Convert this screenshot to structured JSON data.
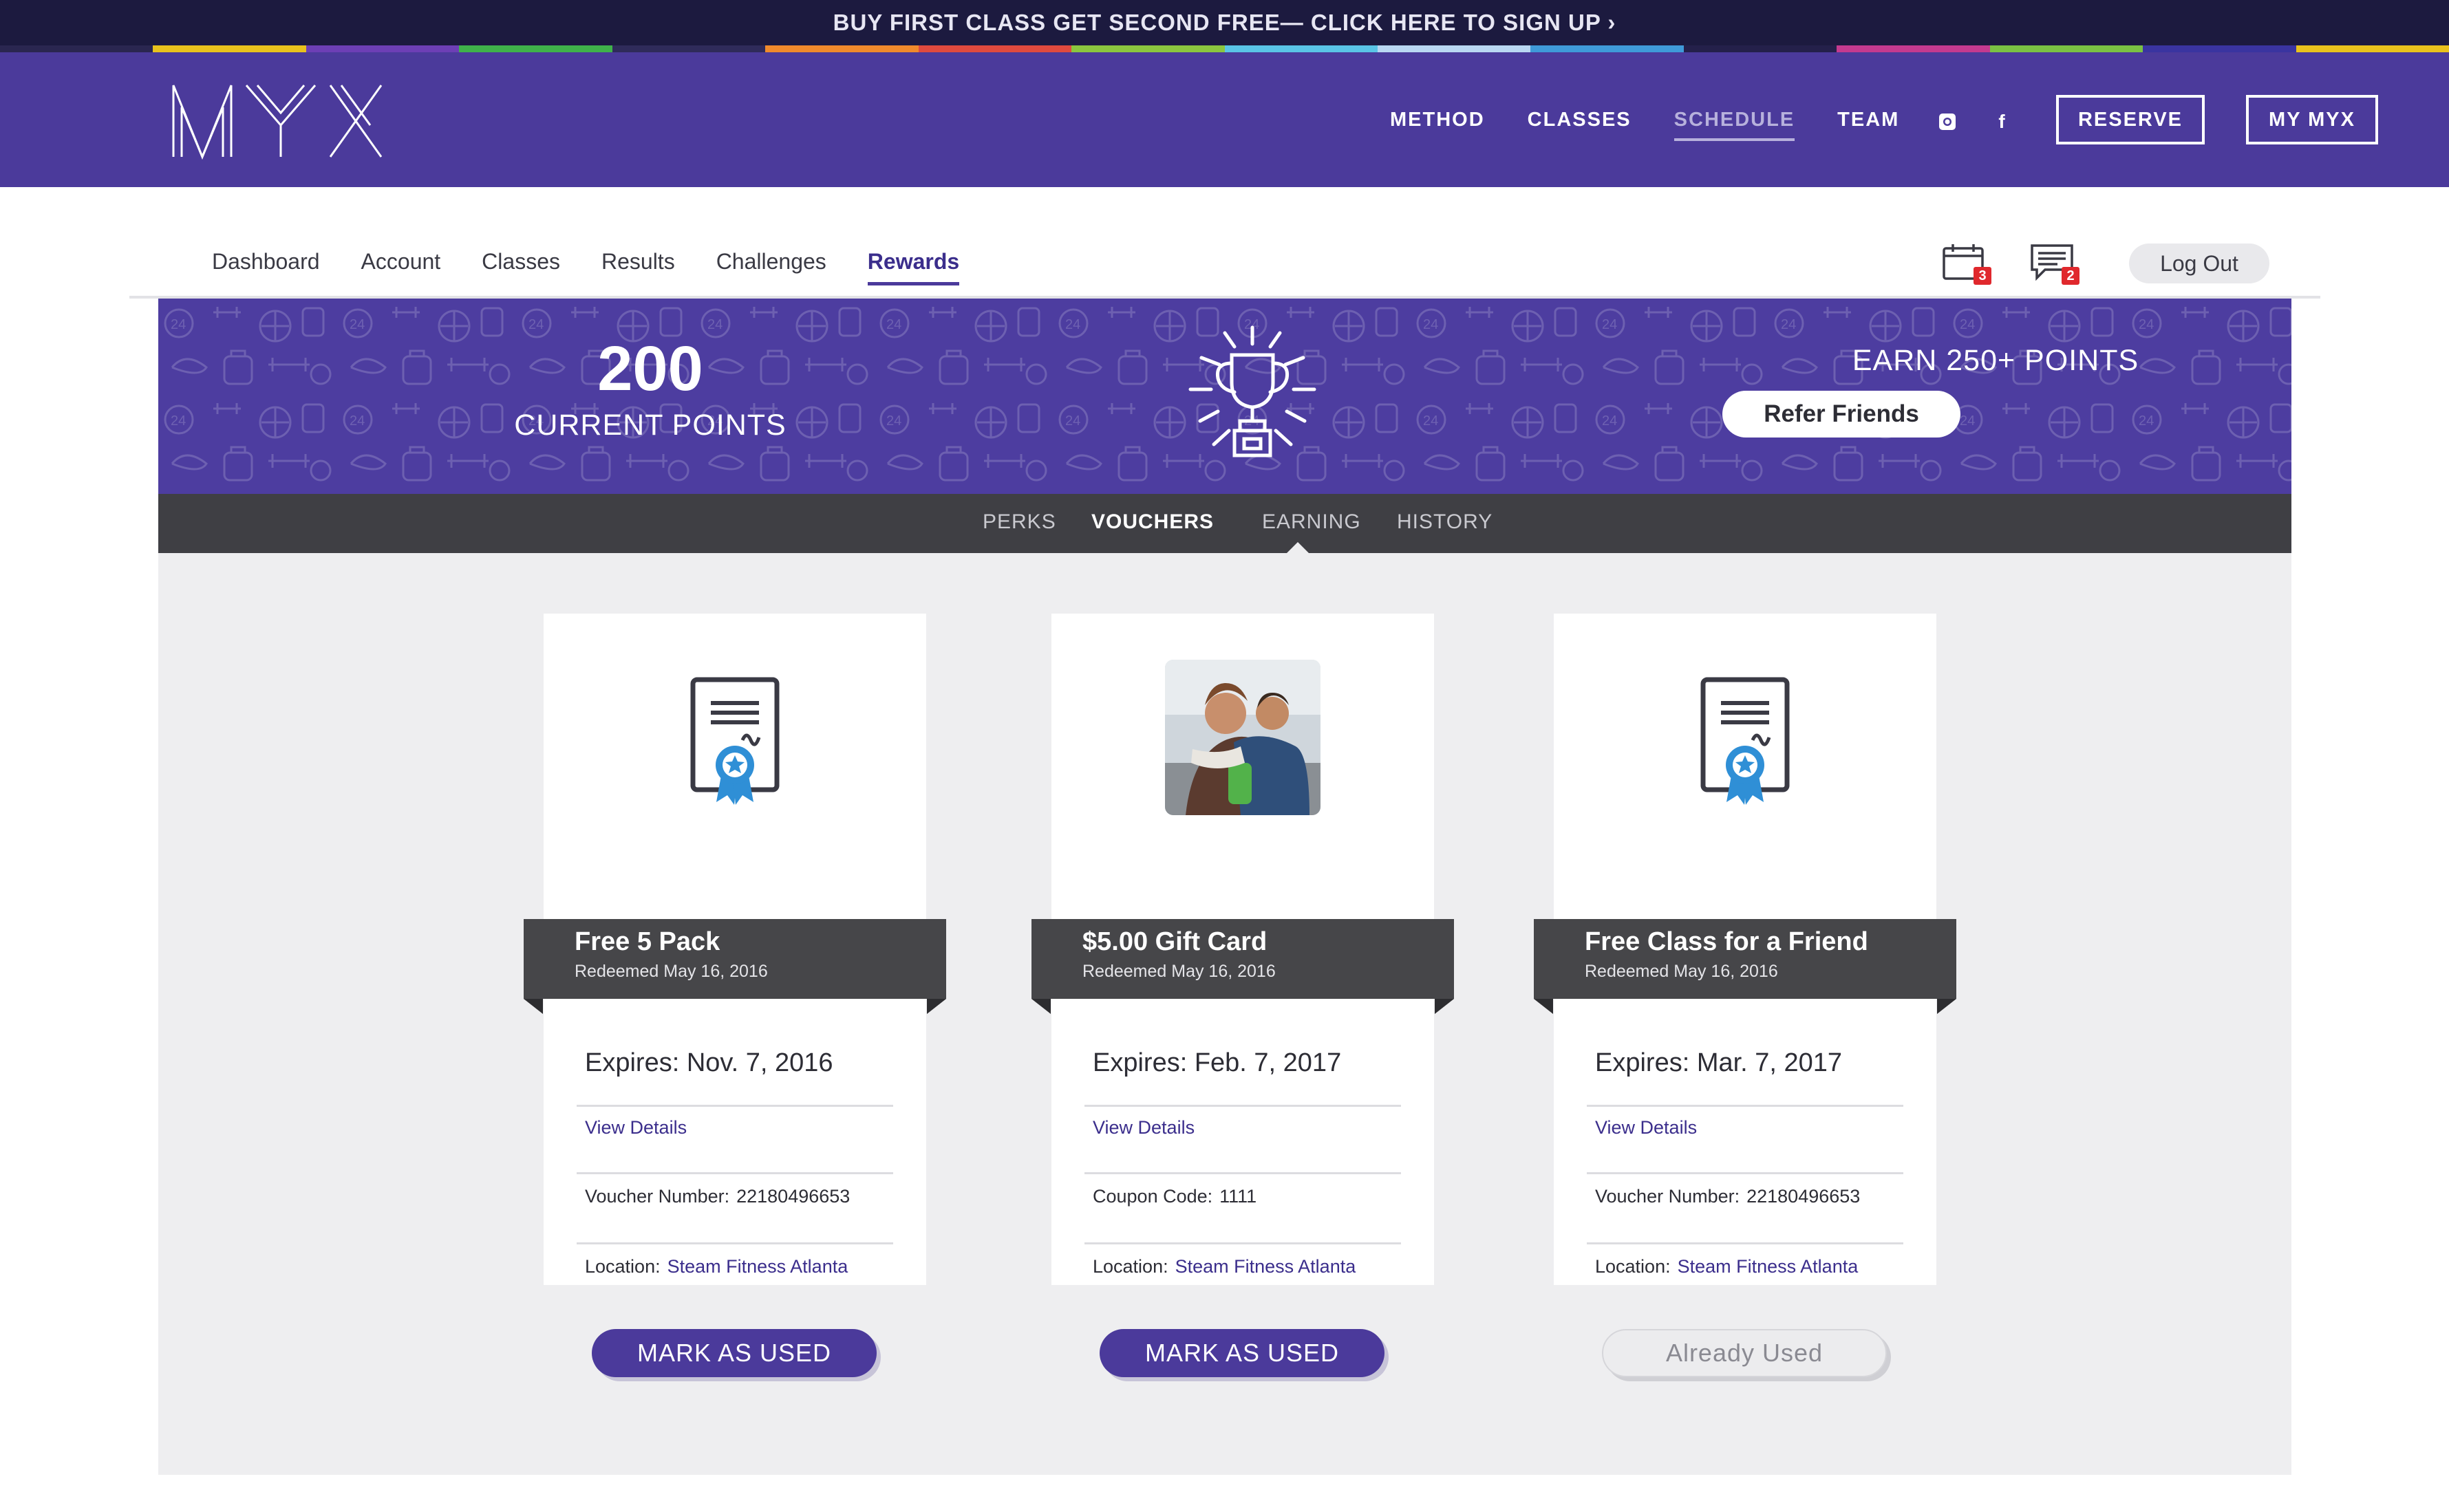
{
  "promo": {
    "text": "BUY FIRST CLASS GET SECOND FREE— CLICK HERE TO SIGN UP ›"
  },
  "header": {
    "logo_text": "MYX",
    "nav": [
      {
        "label": "METHOD",
        "active": false
      },
      {
        "label": "CLASSES",
        "active": false
      },
      {
        "label": "SCHEDULE",
        "active": true
      },
      {
        "label": "TEAM",
        "active": false
      }
    ],
    "social_icons": [
      "instagram-icon",
      "facebook-icon"
    ],
    "facebook_glyph": "f",
    "reserve_label": "RESERVE",
    "mymyx_label": "MY MYX"
  },
  "subnav": {
    "links": [
      {
        "label": "Dashboard",
        "active": false
      },
      {
        "label": "Account",
        "active": false
      },
      {
        "label": "Classes",
        "active": false
      },
      {
        "label": "Results",
        "active": false
      },
      {
        "label": "Challenges",
        "active": false
      },
      {
        "label": "Rewards",
        "active": true
      }
    ],
    "calendar_badge": "3",
    "messages_badge": "2",
    "logout_label": "Log Out"
  },
  "banner": {
    "points": "200",
    "points_label": "CURRENT POINTS",
    "earn_text": "EARN 250+ POINTS",
    "refer_label": "Refer Friends"
  },
  "tabs": [
    {
      "label": "PERKS",
      "active": false
    },
    {
      "label": "VOUCHERS",
      "active": true
    },
    {
      "label": "EARNING",
      "active": false
    },
    {
      "label": "HISTORY",
      "active": false
    }
  ],
  "vouchers": [
    {
      "title": "Free 5 Pack",
      "redeemed": "Redeemed May 16, 2016",
      "expires": "Expires: Nov. 7, 2016",
      "details_link": "View Details",
      "code_label": "Voucher Number:",
      "code_value": "22180496653",
      "location_label": "Location:",
      "location_value": "Steam Fitness Atlanta",
      "action_label": "MARK AS USED",
      "used": false,
      "media": "certificate-icon"
    },
    {
      "title": "$5.00 Gift Card",
      "redeemed": "Redeemed May 16, 2016",
      "expires": "Expires: Feb. 7, 2017",
      "details_link": "View Details",
      "code_label": "Coupon Code:",
      "code_value": "1111",
      "location_label": "Location:",
      "location_value": "Steam Fitness Atlanta",
      "action_label": "MARK AS USED",
      "used": false,
      "media": "photo"
    },
    {
      "title": "Free Class for a Friend",
      "redeemed": "Redeemed May 16, 2016",
      "expires": "Expires: Mar. 7, 2017",
      "details_link": "View Details",
      "code_label": "Voucher Number:",
      "code_value": "22180496653",
      "location_label": "Location:",
      "location_value": "Steam Fitness Atlanta",
      "action_label": "Already Used",
      "used": true,
      "media": "certificate-icon"
    }
  ],
  "colors": {
    "brand_purple": "#4b3a9b",
    "dark_bar": "#3f3f44",
    "ribbon": "#464649",
    "link": "#3b2e8c",
    "badge_red": "#e0282d"
  }
}
